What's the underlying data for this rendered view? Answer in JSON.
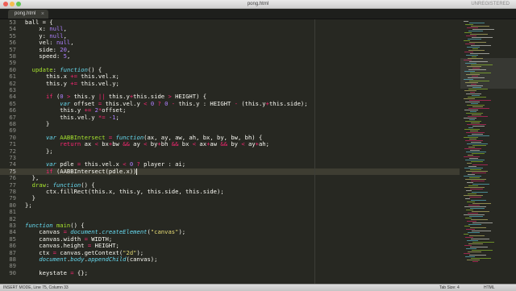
{
  "window": {
    "title": "pong.html",
    "registration": "UNREGISTERED"
  },
  "tabs": [
    {
      "label": "pong.html",
      "close_glyph": "×"
    }
  ],
  "editor": {
    "cursor_line": 75,
    "lines": [
      {
        "n": "53",
        "t": [
          [
            "ball = {",
            ""
          ]
        ]
      },
      {
        "n": "54",
        "t": [
          [
            "    x: ",
            ""
          ],
          [
            "null",
            "num"
          ],
          [
            ",",
            ""
          ]
        ]
      },
      {
        "n": "55",
        "t": [
          [
            "    y: ",
            ""
          ],
          [
            "null",
            "num"
          ],
          [
            ",",
            ""
          ]
        ]
      },
      {
        "n": "56",
        "t": [
          [
            "    vel: ",
            ""
          ],
          [
            "null",
            "num"
          ],
          [
            ",",
            ""
          ]
        ]
      },
      {
        "n": "57",
        "t": [
          [
            "    side: ",
            ""
          ],
          [
            "20",
            "num"
          ],
          [
            ",",
            ""
          ]
        ]
      },
      {
        "n": "58",
        "t": [
          [
            "    speed: ",
            ""
          ],
          [
            "5",
            "num"
          ],
          [
            ",",
            ""
          ]
        ]
      },
      {
        "n": "59",
        "t": []
      },
      {
        "n": "60",
        "t": [
          [
            "  ",
            ""
          ],
          [
            "update",
            "fn"
          ],
          [
            ": ",
            ""
          ],
          [
            "function",
            "pr"
          ],
          [
            "() {",
            ""
          ]
        ]
      },
      {
        "n": "61",
        "t": [
          [
            "      this.x ",
            ""
          ],
          [
            "+=",
            "kw"
          ],
          [
            " this.vel.x;",
            ""
          ]
        ]
      },
      {
        "n": "62",
        "t": [
          [
            "      this.y ",
            ""
          ],
          [
            "+=",
            "kw"
          ],
          [
            " this.vel.y;",
            ""
          ]
        ]
      },
      {
        "n": "63",
        "t": []
      },
      {
        "n": "64",
        "t": [
          [
            "      ",
            ""
          ],
          [
            "if",
            "kw"
          ],
          [
            " (",
            ""
          ],
          [
            "0",
            "num"
          ],
          [
            " ",
            ""
          ],
          [
            ">",
            "kw"
          ],
          [
            " this.y ",
            ""
          ],
          [
            "||",
            "kw"
          ],
          [
            " this.y",
            ""
          ],
          [
            "+",
            "kw"
          ],
          [
            "this.side ",
            ""
          ],
          [
            ">",
            "kw"
          ],
          [
            " HEIGHT) {",
            ""
          ]
        ]
      },
      {
        "n": "65",
        "t": [
          [
            "          ",
            ""
          ],
          [
            "var",
            "pr"
          ],
          [
            " offset ",
            ""
          ],
          [
            "=",
            "kw"
          ],
          [
            " this.vel.y ",
            ""
          ],
          [
            "<",
            "kw"
          ],
          [
            " ",
            ""
          ],
          [
            "0",
            "num"
          ],
          [
            " ",
            ""
          ],
          [
            "?",
            "kw"
          ],
          [
            " ",
            ""
          ],
          [
            "0",
            "num"
          ],
          [
            " ",
            ""
          ],
          [
            "-",
            "kw"
          ],
          [
            " this.y : HEIGHT ",
            ""
          ],
          [
            "-",
            "kw"
          ],
          [
            " (this.y",
            ""
          ],
          [
            "+",
            "kw"
          ],
          [
            "this.side);",
            ""
          ]
        ]
      },
      {
        "n": "66",
        "t": [
          [
            "          this.y ",
            ""
          ],
          [
            "+=",
            "kw"
          ],
          [
            " ",
            ""
          ],
          [
            "2",
            "num"
          ],
          [
            "*",
            "kw"
          ],
          [
            "offset;",
            ""
          ]
        ]
      },
      {
        "n": "67",
        "t": [
          [
            "          this.vel.y ",
            ""
          ],
          [
            "*=",
            "kw"
          ],
          [
            " ",
            ""
          ],
          [
            "-1",
            "num"
          ],
          [
            ";",
            ""
          ]
        ]
      },
      {
        "n": "68",
        "t": [
          [
            "      }",
            ""
          ]
        ]
      },
      {
        "n": "69",
        "t": []
      },
      {
        "n": "70",
        "t": [
          [
            "      ",
            ""
          ],
          [
            "var",
            "pr"
          ],
          [
            " ",
            ""
          ],
          [
            "AABBIntersect",
            "fn"
          ],
          [
            " ",
            ""
          ],
          [
            "=",
            "kw"
          ],
          [
            " ",
            ""
          ],
          [
            "function",
            "pr"
          ],
          [
            "(ax, ay, aw, ah, bx, by, bw, bh) {",
            ""
          ]
        ]
      },
      {
        "n": "71",
        "t": [
          [
            "          ",
            ""
          ],
          [
            "return",
            "kw"
          ],
          [
            " ax ",
            ""
          ],
          [
            "<",
            "kw"
          ],
          [
            " bx",
            ""
          ],
          [
            "+",
            "kw"
          ],
          [
            "bw ",
            ""
          ],
          [
            "&&",
            "kw"
          ],
          [
            " ay ",
            ""
          ],
          [
            "<",
            "kw"
          ],
          [
            " by",
            ""
          ],
          [
            "+",
            "kw"
          ],
          [
            "bh ",
            ""
          ],
          [
            "&&",
            "kw"
          ],
          [
            " bx ",
            ""
          ],
          [
            "<",
            "kw"
          ],
          [
            " ax",
            ""
          ],
          [
            "+",
            "kw"
          ],
          [
            "aw ",
            ""
          ],
          [
            "&&",
            "kw"
          ],
          [
            " by ",
            ""
          ],
          [
            "<",
            "kw"
          ],
          [
            " ay",
            ""
          ],
          [
            "+",
            "kw"
          ],
          [
            "ah;",
            ""
          ]
        ]
      },
      {
        "n": "72",
        "t": [
          [
            "      };",
            ""
          ]
        ]
      },
      {
        "n": "73",
        "t": []
      },
      {
        "n": "74",
        "t": [
          [
            "      ",
            ""
          ],
          [
            "var",
            "pr"
          ],
          [
            " pdle ",
            ""
          ],
          [
            "=",
            "kw"
          ],
          [
            " this.vel.x ",
            ""
          ],
          [
            "<",
            "kw"
          ],
          [
            " ",
            ""
          ],
          [
            "0",
            "num"
          ],
          [
            " ",
            ""
          ],
          [
            "?",
            "kw"
          ],
          [
            " player : ai;",
            ""
          ]
        ]
      },
      {
        "n": "75",
        "t": [
          [
            "      ",
            ""
          ],
          [
            "if",
            "kw"
          ],
          [
            " (AABBIntersect(pdle.x))",
            ""
          ]
        ]
      },
      {
        "n": "76",
        "t": [
          [
            "  },",
            ""
          ]
        ]
      },
      {
        "n": "77",
        "t": [
          [
            "  ",
            ""
          ],
          [
            "draw",
            "fn"
          ],
          [
            ": ",
            ""
          ],
          [
            "function",
            "pr"
          ],
          [
            "() {",
            ""
          ]
        ]
      },
      {
        "n": "78",
        "t": [
          [
            "      ctx.fillRect(this.x, this.y, this.side, this.side);",
            ""
          ]
        ]
      },
      {
        "n": "79",
        "t": [
          [
            "  }",
            ""
          ]
        ]
      },
      {
        "n": "80",
        "t": [
          [
            "};",
            ""
          ]
        ]
      },
      {
        "n": "81",
        "t": []
      },
      {
        "n": "82",
        "t": []
      },
      {
        "n": "83",
        "t": [
          [
            "function",
            "pr"
          ],
          [
            " ",
            ""
          ],
          [
            "main",
            "fn"
          ],
          [
            "() {",
            ""
          ]
        ]
      },
      {
        "n": "84",
        "t": [
          [
            "    canvas ",
            ""
          ],
          [
            "=",
            "kw"
          ],
          [
            " ",
            ""
          ],
          [
            "document",
            "pr"
          ],
          [
            ".",
            ""
          ],
          [
            "createElement",
            "pr"
          ],
          [
            "(",
            ""
          ],
          [
            "\"canvas\"",
            "str"
          ],
          [
            ");",
            ""
          ]
        ]
      },
      {
        "n": "85",
        "t": [
          [
            "    canvas.width ",
            ""
          ],
          [
            "=",
            "kw"
          ],
          [
            " WIDTH;",
            ""
          ]
        ]
      },
      {
        "n": "86",
        "t": [
          [
            "    canvas.height ",
            ""
          ],
          [
            "=",
            "kw"
          ],
          [
            " HEIGHT;",
            ""
          ]
        ]
      },
      {
        "n": "87",
        "t": [
          [
            "    ctx ",
            ""
          ],
          [
            "=",
            "kw"
          ],
          [
            " canvas.getContext(",
            ""
          ],
          [
            "\"2d\"",
            "str"
          ],
          [
            ");",
            ""
          ]
        ]
      },
      {
        "n": "88",
        "t": [
          [
            "    ",
            ""
          ],
          [
            "document",
            "pr"
          ],
          [
            ".",
            ""
          ],
          [
            "body",
            "pr"
          ],
          [
            ".",
            ""
          ],
          [
            "appendChild",
            "pr"
          ],
          [
            "(canvas);",
            ""
          ]
        ]
      },
      {
        "n": "89",
        "t": []
      },
      {
        "n": "90",
        "t": [
          [
            "    keystate ",
            ""
          ],
          [
            "=",
            "kw"
          ],
          [
            " {};",
            ""
          ]
        ]
      }
    ]
  },
  "status": {
    "left": "INSERT MODE, Line 75, Column 33",
    "tab_size": "Tab Size: 4",
    "syntax": "HTML"
  },
  "colors": {
    "background": "#272822",
    "keyword": "#f92672",
    "function_name": "#a6e22e",
    "string": "#e6db74",
    "number": "#ae81ff",
    "storage": "#66d9ef",
    "current_line": "#3e3d32"
  }
}
